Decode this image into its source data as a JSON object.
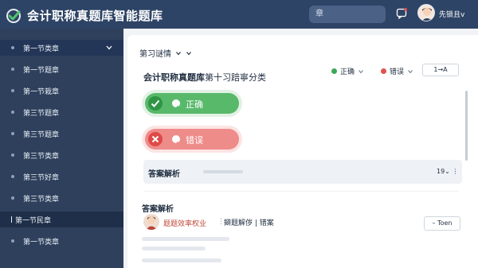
{
  "app": {
    "title": "会计职称真题库智能题库",
    "search_placeholder": "章",
    "user_name": "先锁且v"
  },
  "sidebar": {
    "items": [
      {
        "label": "第一节类章"
      },
      {
        "label": "第一节题章"
      },
      {
        "label": "第一节栽章"
      },
      {
        "label": "第三节题章"
      },
      {
        "label": "第三节题章"
      },
      {
        "label": "第三节类章"
      },
      {
        "label": "第三节好章"
      },
      {
        "label": "第三节类章"
      },
      {
        "label": "第一节民章"
      },
      {
        "label": "第一节类章"
      }
    ]
  },
  "main": {
    "breadcrumb": "第习谜情",
    "question_title_bold": "会计职称真题库",
    "question_title_rest": "第十习踣寧分类",
    "legend": {
      "correct": "正确",
      "wrong": "错误",
      "correct_color": "#3aa857",
      "wrong_color": "#e05250"
    },
    "sort_button": "1→A",
    "options": {
      "correct_label": "正确",
      "wrong_label": "错误"
    },
    "answer_bar": {
      "title": "答案解析",
      "count": "19⌄ ⋮"
    },
    "analysis": {
      "title": "答案解析",
      "comment_user": "题题效率权业",
      "comment_sep": "⋮",
      "comment_text": "鐴题解㑕 | 错案",
      "toen_button": "– Toen"
    }
  }
}
